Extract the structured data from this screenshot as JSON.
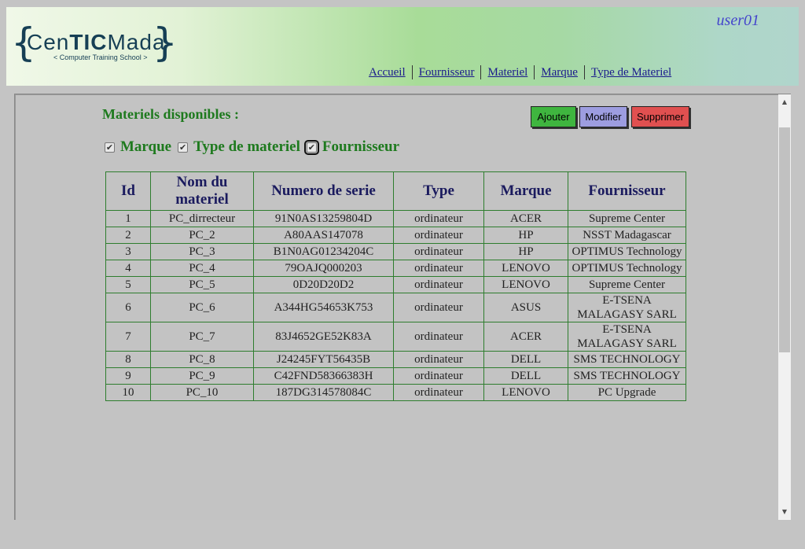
{
  "header": {
    "logo": {
      "brand_pre": "Cen",
      "brand_mid": "TIC",
      "brand_post": "Mada",
      "tagline": "< Computer Training School >"
    },
    "user": "user01",
    "nav": [
      "Accueil",
      "Fournisseur",
      "Materiel",
      "Marque",
      "Type de Materiel"
    ]
  },
  "main": {
    "title": "Materiels disponibles :",
    "buttons": {
      "add": "Ajouter",
      "edit": "Modifier",
      "delete": "Supprimer"
    },
    "filters": [
      {
        "label": "Marque",
        "checked": true
      },
      {
        "label": "Type de materiel",
        "checked": true
      },
      {
        "label": "Fournisseur",
        "checked": true
      }
    ],
    "table": {
      "headers": [
        "Id",
        "Nom du materiel",
        "Numero de serie",
        "Type",
        "Marque",
        "Fournisseur"
      ],
      "rows": [
        [
          "1",
          "PC_dirrecteur",
          "91N0AS13259804D",
          "ordinateur",
          "ACER",
          "Supreme Center"
        ],
        [
          "2",
          "PC_2",
          "A80AAS147078",
          "ordinateur",
          "HP",
          "NSST Madagascar"
        ],
        [
          "3",
          "PC_3",
          "B1N0AG01234204C",
          "ordinateur",
          "HP",
          "OPTIMUS Technology"
        ],
        [
          "4",
          "PC_4",
          "79OAJQ000203",
          "ordinateur",
          "LENOVO",
          "OPTIMUS Technology"
        ],
        [
          "5",
          "PC_5",
          "0D20D20D2",
          "ordinateur",
          "LENOVO",
          "Supreme Center"
        ],
        [
          "6",
          "PC_6",
          "A344HG54653K753",
          "ordinateur",
          "ASUS",
          "E-TSENA MALAGASY SARL"
        ],
        [
          "7",
          "PC_7",
          "83J4652GE52K83A",
          "ordinateur",
          "ACER",
          "E-TSENA MALAGASY SARL"
        ],
        [
          "8",
          "PC_8",
          "J24245FYT56435B",
          "ordinateur",
          "DELL",
          "SMS TECHNOLOGY"
        ],
        [
          "9",
          "PC_9",
          "C42FND58366383H",
          "ordinateur",
          "DELL",
          "SMS TECHNOLOGY"
        ],
        [
          "10",
          "PC_10",
          "187DG314578084C",
          "ordinateur",
          "LENOVO",
          "PC Upgrade"
        ]
      ]
    }
  }
}
